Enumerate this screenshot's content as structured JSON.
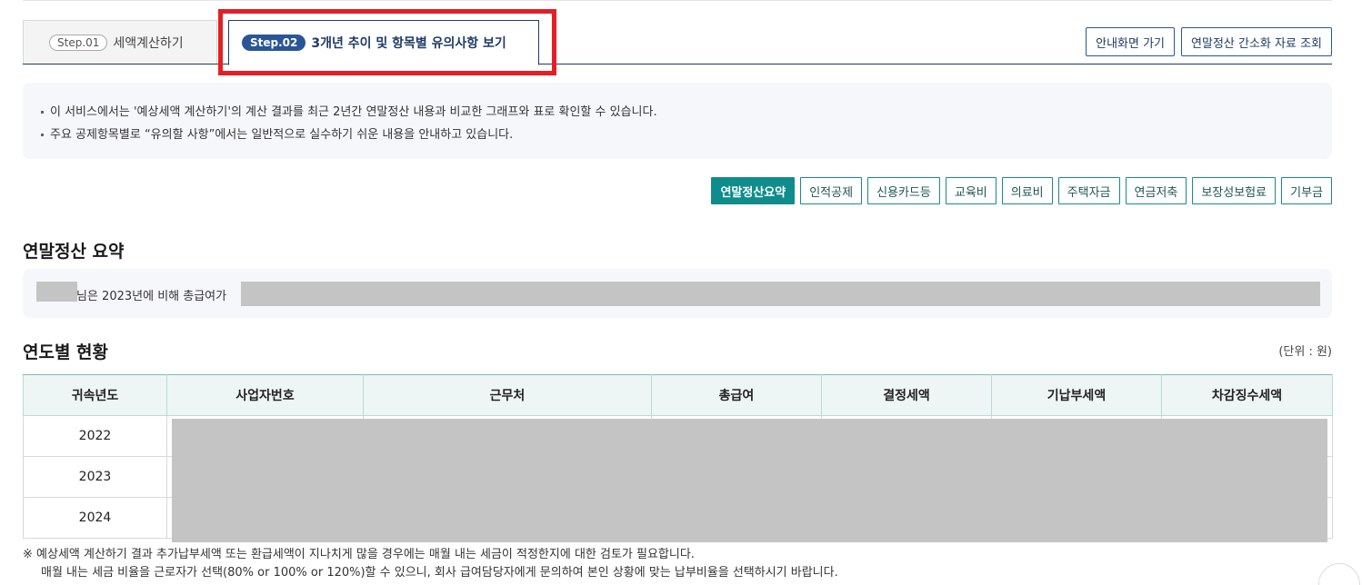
{
  "tabs": {
    "step1": {
      "badge": "Step.01",
      "label": "세액계산하기"
    },
    "step2": {
      "badge": "Step.02",
      "label": "3개년 추이 및 항목별 유의사항 보기"
    }
  },
  "top_buttons": {
    "guide": "안내화면 가기",
    "simple_data": "연말정산 간소화 자료 조회"
  },
  "info": {
    "line1": "이 서비스에서는 '예상세액 계산하기'의 계산 결과를 최근 2년간 연말정산 내용과 비교한 그래프와 표로 확인할 수 있습니다.",
    "line2": "주요 공제항목별로 “유의할 사항”에서는 일반적으로 실수하기 쉬운 내용을 안내하고 있습니다."
  },
  "categories": [
    {
      "label": "연말정산요약",
      "active": true
    },
    {
      "label": "인적공제",
      "active": false
    },
    {
      "label": "신용카드등",
      "active": false
    },
    {
      "label": "교육비",
      "active": false
    },
    {
      "label": "의료비",
      "active": false
    },
    {
      "label": "주택자금",
      "active": false
    },
    {
      "label": "연금저축",
      "active": false
    },
    {
      "label": "보장성보험료",
      "active": false
    },
    {
      "label": "기부금",
      "active": false
    }
  ],
  "summary": {
    "title": "연말정산 요약",
    "text": "님은 2023년에 비해 총급여가"
  },
  "yearly": {
    "title": "연도별 현황",
    "unit": "(단위 : 원)",
    "headers": [
      "귀속년도",
      "사업자번호",
      "근무처",
      "총급여",
      "결정세액",
      "기납부세액",
      "차감징수세액"
    ],
    "years": [
      "2022",
      "2023",
      "2024"
    ]
  },
  "footnote": {
    "line1": "※ 예상세액 계산하기 결과 추가납부세액 또는 환급세액이 지나치게 많을 경우에는 매월 내는 세금이 적정한지에 대한 검토가 필요합니다.",
    "line2": "매월 내는 세금 비율을 근로자가 선택(80% or 100% or 120%)할 수 있으니, 회사 급여담당자에게 문의하여 본인 상황에 맞는 납부비율을 선택하시기 바랍니다."
  },
  "colors": {
    "navy": "#1f3b66",
    "teal": "#0f8c8c",
    "highlight_red": "#e61e25"
  }
}
